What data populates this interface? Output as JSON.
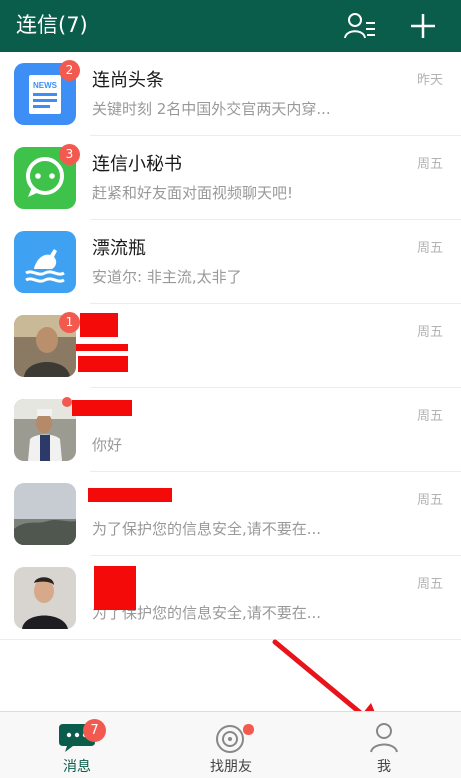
{
  "header": {
    "title": "连信(7)",
    "contacts_icon": "contacts-icon",
    "add_icon": "plus-icon"
  },
  "chats": [
    {
      "name": "连尚头条",
      "preview": "关键时刻 2名中国外交官两天内穿...",
      "time": "昨天",
      "badge": "2",
      "avatar": "news-icon"
    },
    {
      "name": "连信小秘书",
      "preview": "赶紧和好友面对面视频聊天吧!",
      "time": "周五",
      "badge": "3",
      "avatar": "chat-bubble-icon"
    },
    {
      "name": "漂流瓶",
      "preview": "安道尔: 非主流,太非了",
      "time": "周五",
      "badge": "",
      "avatar": "drift-bottle-icon"
    },
    {
      "name": "",
      "preview": "",
      "time": "周五",
      "badge": "1",
      "avatar": "user-photo"
    },
    {
      "name": "",
      "preview": "你好",
      "time": "周五",
      "badge": "",
      "avatar": "user-photo"
    },
    {
      "name": "",
      "preview": "为了保护您的信息安全,请不要在...",
      "time": "周五",
      "badge": "",
      "avatar": "landscape-photo"
    },
    {
      "name": "",
      "preview": "为了保护您的信息安全,请不要在...",
      "time": "周五",
      "badge": "",
      "avatar": "user-photo"
    }
  ],
  "nav": {
    "tabs": [
      {
        "label": "消息",
        "badge": "7",
        "icon": "message-icon",
        "active": true
      },
      {
        "label": "找朋友",
        "icon": "find-friends-icon",
        "active": false
      },
      {
        "label": "我",
        "icon": "profile-icon",
        "active": false
      }
    ]
  },
  "colors": {
    "header": "#0a5c4b",
    "badge": "#f25a4f",
    "annotation_arrow": "#e8131b"
  }
}
